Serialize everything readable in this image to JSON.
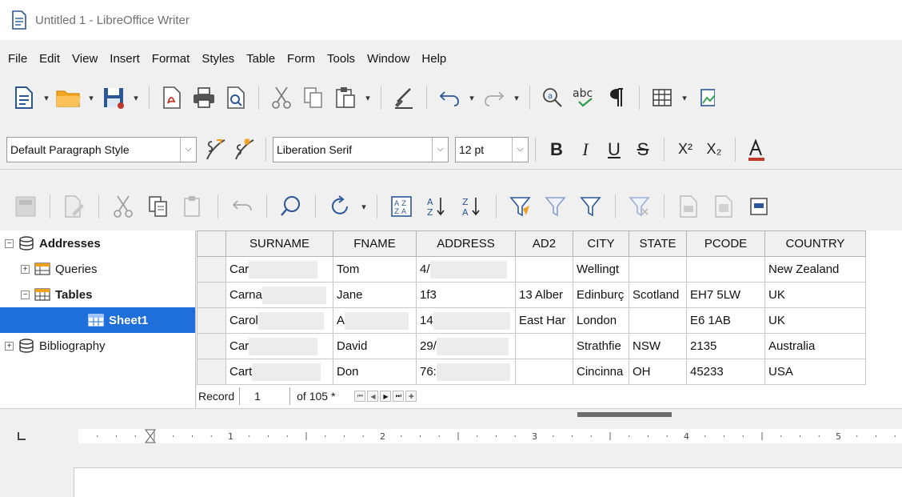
{
  "window": {
    "title": "Untitled 1 - LibreOffice Writer"
  },
  "menu": [
    "File",
    "Edit",
    "View",
    "Insert",
    "Format",
    "Styles",
    "Table",
    "Form",
    "Tools",
    "Window",
    "Help"
  ],
  "format_bar": {
    "paragraph_style": "Default Paragraph Style",
    "font_name": "Liberation Serif",
    "font_size": "12 pt",
    "bold": "B",
    "italic": "I",
    "underline": "U",
    "strike": "S",
    "superscript": "X²",
    "subscript": "X₂"
  },
  "tree": {
    "addresses": "Addresses",
    "queries": "Queries",
    "tables": "Tables",
    "sheet1": "Sheet1",
    "bibliography": "Bibliography"
  },
  "grid": {
    "columns": [
      "SURNAME",
      "FNAME",
      "ADDRESS",
      "AD2",
      "CITY",
      "STATE",
      "PCODE",
      "COUNTRY"
    ],
    "rows": [
      [
        "Car",
        "Tom",
        "4/",
        "",
        "Wellingt",
        "",
        "",
        "New Zealand"
      ],
      [
        "Carna",
        "Jane",
        "1f3",
        "13 Alber",
        "Edinburç",
        "Scotland",
        "EH7 5LW",
        "UK"
      ],
      [
        "Carol",
        "A",
        "14",
        "East Har",
        "London",
        "",
        "E6 1AB",
        "UK"
      ],
      [
        "Car",
        "David",
        "29/",
        "",
        "Strathfie",
        "NSW",
        "2135",
        "Australia"
      ],
      [
        "Cart",
        "Don",
        "76:",
        "",
        "Cincinna",
        "OH",
        "45233",
        "USA"
      ]
    ]
  },
  "record_bar": {
    "label": "Record",
    "current": "1",
    "of_text": "of 105 *"
  },
  "ruler": {
    "numbers": [
      "1",
      "2",
      "3",
      "4",
      "5"
    ]
  },
  "colors": {
    "selection": "#1e6fd9",
    "save_red": "#c0392b",
    "folder_orange": "#f5a623"
  }
}
